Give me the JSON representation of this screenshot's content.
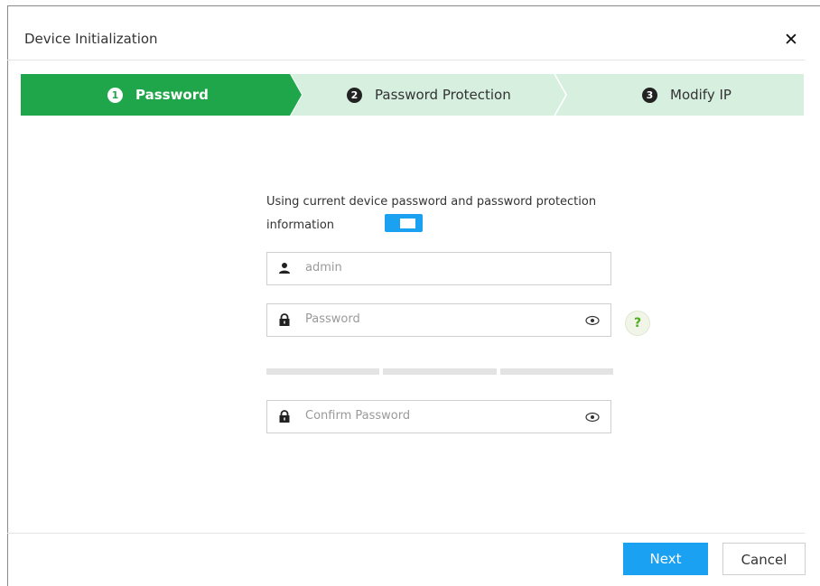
{
  "dialog": {
    "title": "Device Initialization",
    "close_symbol": "✕"
  },
  "steps": [
    {
      "number": "1",
      "label": "Password",
      "state": "active"
    },
    {
      "number": "2",
      "label": "Password Protection",
      "state": "pending"
    },
    {
      "number": "3",
      "label": "Modify IP",
      "state": "pending"
    }
  ],
  "form": {
    "consent_text": "Using current device password and password protection information",
    "consent_toggle_on": true,
    "username": {
      "placeholder": "admin",
      "icon": "user-icon"
    },
    "password": {
      "placeholder": "Password",
      "icon": "lock-icon",
      "reveal_icon": "eye-icon"
    },
    "help_symbol": "?",
    "confirm_password": {
      "placeholder": "Confirm Password",
      "icon": "lock-icon",
      "reveal_icon": "eye-icon"
    },
    "strength_segments": 3
  },
  "buttons": {
    "next": "Next",
    "cancel": "Cancel"
  },
  "colors": {
    "step_active": "#1fa64a",
    "step_pending": "#d6efdf",
    "accent": "#1ba1f2"
  }
}
